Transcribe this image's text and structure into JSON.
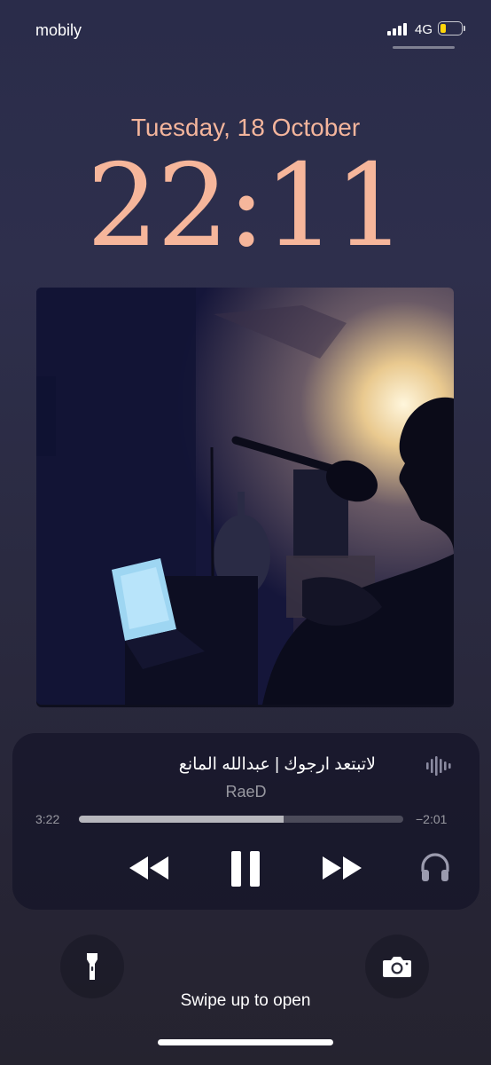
{
  "status_bar": {
    "carrier": "mobily",
    "network": "4G",
    "battery_level": 0.25,
    "battery_color": "#ffd60a"
  },
  "lock_screen": {
    "date": "Tuesday, 18 October",
    "time": "22:11",
    "accent_color": "#f6b69b"
  },
  "now_playing": {
    "title": "لاتبتعد ارجوك | عبدالله المانع",
    "artist": "RaeD",
    "elapsed": "3:22",
    "remaining": "−2:01",
    "progress": 0.63,
    "controls": [
      "rewind-icon",
      "pause-icon",
      "fast-forward-icon",
      "headphones-icon"
    ],
    "waveform_icon": "waveform-icon"
  },
  "quick_actions": {
    "left": "flashlight-icon",
    "right": "camera-icon"
  },
  "hint": "Swipe up to open"
}
